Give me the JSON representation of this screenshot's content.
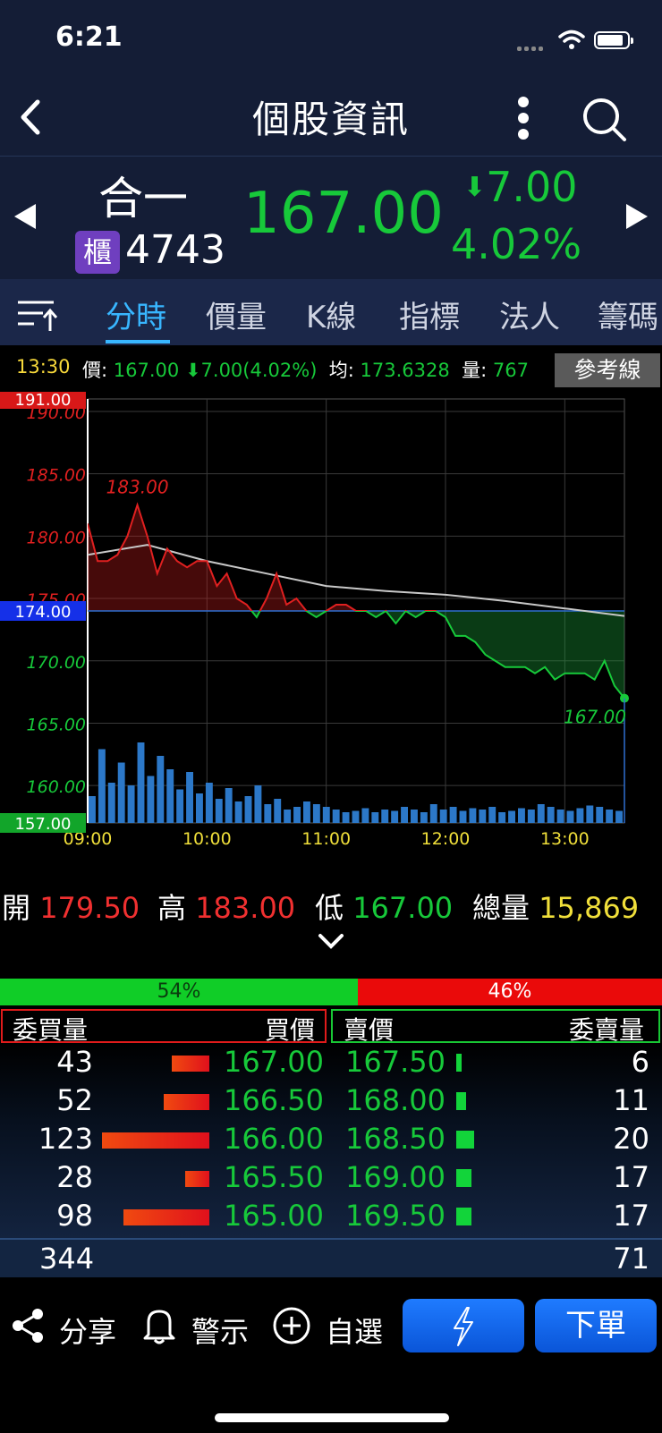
{
  "status_bar": {
    "time": "6:21"
  },
  "nav": {
    "title": "個股資訊"
  },
  "stock": {
    "name": "合一",
    "market_badge": "櫃",
    "code": "4743",
    "price": "167.00",
    "change": "7.00",
    "change_arrow": "⬇",
    "change_pct": "4.02%"
  },
  "tabs": [
    "分時",
    "價量",
    "K線",
    "指標",
    "法人",
    "籌碼"
  ],
  "info_line": {
    "time": "13:30",
    "price_label": "價:",
    "price": "167.00",
    "change": "⬇7.00(4.02%)",
    "avg_label": "均:",
    "avg": "173.6328",
    "vol_label": "量:",
    "vol": "767",
    "ref_line_button": "參考線"
  },
  "chart_data": {
    "type": "line",
    "title": "",
    "x_ticks": [
      "09:00",
      "10:00",
      "11:00",
      "12:00",
      "13:00"
    ],
    "y_ticks": [
      "190.00",
      "185.00",
      "180.00",
      "175.00",
      "170.00",
      "165.00",
      "160.00"
    ],
    "ylim": [
      157.0,
      191.0
    ],
    "limit_up": "191.00",
    "limit_down": "157.00",
    "reference": "174.00",
    "high_label": "183.00",
    "last_label": "167.00",
    "series": [
      {
        "x": [
          "09:00",
          "09:05",
          "09:10",
          "09:15",
          "09:20",
          "09:25",
          "09:30",
          "09:35",
          "09:40",
          "09:45",
          "09:50",
          "09:55",
          "10:00",
          "10:05",
          "10:10",
          "10:15",
          "10:20",
          "10:25",
          "10:30",
          "10:35",
          "10:40",
          "10:45",
          "10:50",
          "10:55",
          "11:00",
          "11:05",
          "11:10",
          "11:15",
          "11:20",
          "11:25",
          "11:30",
          "11:35",
          "11:40",
          "11:45",
          "11:50",
          "11:55",
          "12:00",
          "12:05",
          "12:10",
          "12:15",
          "12:20",
          "12:25",
          "12:30",
          "12:35",
          "12:40",
          "12:45",
          "12:50",
          "12:55",
          "13:00",
          "13:05",
          "13:10",
          "13:15",
          "13:20",
          "13:25",
          "13:30"
        ],
        "values": [
          181,
          178,
          178,
          178.5,
          180,
          182.5,
          180,
          177,
          179,
          178,
          177.5,
          178,
          178,
          176,
          177,
          175,
          174.5,
          173.5,
          175,
          177,
          174.5,
          175,
          174,
          173.5,
          174,
          174.5,
          174.5,
          174,
          174,
          173.5,
          174,
          173,
          174,
          173.5,
          174,
          174,
          173.5,
          172,
          172,
          171.5,
          170.5,
          170,
          169.5,
          169.5,
          169.5,
          169,
          169.5,
          168.5,
          169,
          169,
          169,
          168.5,
          170,
          168,
          167
        ]
      },
      {
        "x": [
          "09:00",
          "09:30",
          "10:00",
          "10:30",
          "11:00",
          "11:30",
          "12:00",
          "12:30",
          "13:00",
          "13:30"
        ],
        "values": [
          178.5,
          179.3,
          178,
          177,
          176,
          175.6,
          175.3,
          174.8,
          174.2,
          173.6
        ]
      }
    ],
    "volume": [
      20,
      55,
      30,
      45,
      28,
      60,
      35,
      50,
      40,
      25,
      38,
      22,
      30,
      18,
      26,
      16,
      20,
      28,
      14,
      18,
      10,
      12,
      16,
      14,
      12,
      10,
      8,
      9,
      11,
      8,
      10,
      9,
      12,
      10,
      8,
      14,
      10,
      12,
      9,
      11,
      10,
      12,
      8,
      9,
      11,
      10,
      14,
      12,
      10,
      9,
      11,
      13,
      12,
      10,
      9
    ]
  },
  "ohlc": {
    "open_label": "開",
    "open": "179.50",
    "high_label": "高",
    "high": "183.00",
    "low_label": "低",
    "low": "167.00",
    "vol_label": "總量",
    "vol": "15,869"
  },
  "ratio": {
    "buy": "54%",
    "buy_fraction": 0.54,
    "sell": "46%"
  },
  "orderbook": {
    "headers": {
      "bid_qty": "委買量",
      "bid_price": "買價",
      "ask_price": "賣價",
      "ask_qty": "委賣量"
    },
    "rows": [
      {
        "bid_qty": "43",
        "bid_price": "167.00",
        "ask_price": "167.50",
        "ask_qty": "6"
      },
      {
        "bid_qty": "52",
        "bid_price": "166.50",
        "ask_price": "168.00",
        "ask_qty": "11"
      },
      {
        "bid_qty": "123",
        "bid_price": "166.00",
        "ask_price": "168.50",
        "ask_qty": "20"
      },
      {
        "bid_qty": "28",
        "bid_price": "165.50",
        "ask_price": "169.00",
        "ask_qty": "17"
      },
      {
        "bid_qty": "98",
        "bid_price": "165.00",
        "ask_price": "169.50",
        "ask_qty": "17"
      }
    ],
    "total_bid": "344",
    "total_ask": "71"
  },
  "bottom_bar": {
    "share": "分享",
    "alert": "警示",
    "watchlist": "自選",
    "order": "下單"
  },
  "icons": {
    "back": "chevron-left-icon",
    "more": "more-vertical-icon",
    "search": "search-icon",
    "share": "share-icon",
    "alert": "bell-icon",
    "watchlist": "plus-circle-icon",
    "flash": "lightning-icon"
  }
}
